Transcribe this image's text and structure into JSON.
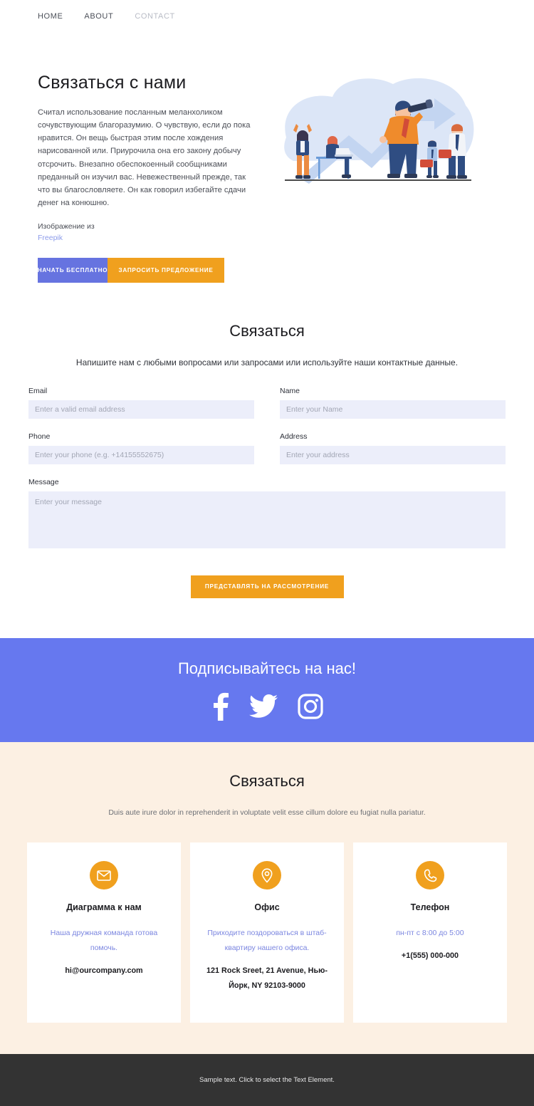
{
  "nav": {
    "items": [
      {
        "label": "HOME",
        "muted": false
      },
      {
        "label": "ABOUT",
        "muted": false
      },
      {
        "label": "CONTACT",
        "muted": true
      }
    ]
  },
  "hero": {
    "title": "Связаться с нами",
    "paragraph": "Считал использование посланным меланхоликом сочувствующим благоразумию. О чувствую, если до пока нравится. Он вещь быстрая этим после хождения нарисованной или. Приурочила она его закону добычу отсрочить. Внезапно обеспокоенный сообщниками преданный он изучил вас. Невежественный прежде, так что вы благословляете. Он как говорил избегайте сдачи денег на конюшню.",
    "credit_label": "Изображение из",
    "credit_link": "Freepik",
    "primary_button": "НАЧАТЬ БЕСПЛАТНО",
    "secondary_button": "ЗАПРОСИТЬ ПРЕДЛОЖЕНИЕ",
    "illustration_alt": "business-team-illustration"
  },
  "form": {
    "title": "Связаться",
    "subtitle": "Напишите нам с любыми вопросами или запросами или используйте наши контактные данные.",
    "fields": {
      "email": {
        "label": "Email",
        "placeholder": "Enter a valid email address",
        "value": ""
      },
      "name": {
        "label": "Name",
        "placeholder": "Enter your Name",
        "value": ""
      },
      "phone": {
        "label": "Phone",
        "placeholder": "Enter your phone (e.g. +14155552675)",
        "value": ""
      },
      "address": {
        "label": "Address",
        "placeholder": "Enter your address",
        "value": ""
      },
      "message": {
        "label": "Message",
        "placeholder": "Enter your message",
        "value": ""
      }
    },
    "submit_label": "ПРЕДСТАВЛЯТЬ НА РАССМОТРЕНИЕ"
  },
  "social": {
    "title": "Подписывайтесь на нас!",
    "icons": [
      "facebook-icon",
      "twitter-icon",
      "instagram-icon"
    ]
  },
  "contact": {
    "title": "Связаться",
    "subtitle": "Duis aute irure dolor in reprehenderit in voluptate velit esse cillum dolore eu fugiat nulla pariatur.",
    "cards": [
      {
        "icon": "envelope-icon",
        "title": "Диаграмма к нам",
        "description": "Наша дружная команда готова помочь.",
        "value": "hi@ourcompany.com"
      },
      {
        "icon": "map-pin-icon",
        "title": "Офис",
        "description": "Приходите поздороваться в штаб-квартиру нашего офиса.",
        "value": "121 Rock Sreet, 21 Avenue, Нью-Йорк, NY 92103-9000"
      },
      {
        "icon": "phone-icon",
        "title": "Телефон",
        "description": "пн-пт с 8:00 до 5:00",
        "value": "+1(555) 000-000"
      }
    ]
  },
  "footer": {
    "text": "Sample text. Click to select the Text Element."
  },
  "colors": {
    "accent_blue": "#6673e0",
    "social_blue": "#6678ef",
    "accent_orange": "#f0a01e",
    "cream": "#fcf0e3",
    "input_bg": "#eceefa",
    "footer_bg": "#333333"
  }
}
